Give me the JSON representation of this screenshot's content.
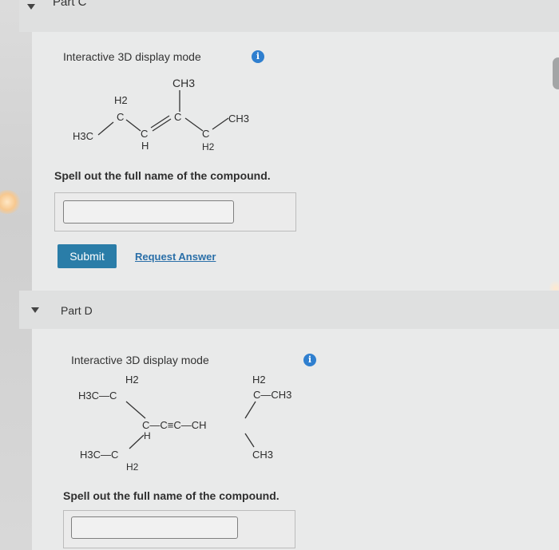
{
  "part_c": {
    "title": "Part C",
    "mode_label": "Interactive 3D display mode",
    "prompt": "Spell out the full name of the compound.",
    "answer_value": "",
    "submit_label": "Submit",
    "request_label": "Request Answer",
    "structure_labels": {
      "ch3_top": "CH3",
      "h2_left": "H2",
      "c_left": "C",
      "ch3_right": "CH3",
      "h3c_left": "H3C",
      "c_right": "C",
      "c_h": "C",
      "h_below": "H",
      "c_h2": "C",
      "h2_below": "H2"
    }
  },
  "part_d": {
    "title": "Part D",
    "mode_label": "Interactive 3D display mode",
    "prompt": "Spell out the full name of the compound.",
    "answer_value": "",
    "structure_labels": {
      "h2_top_left": "H2",
      "h3c_c_top": "H3C—C",
      "h2_top_right": "H2",
      "c_ch3_right": "C—CH3",
      "chain": "C—C≡C—CH",
      "h_mid": "H",
      "h3c_c_bottom": "H3C—C",
      "h2_bottom": "H2",
      "ch3_bottom": "CH3"
    }
  },
  "colors": {
    "accent": "#2a7da8",
    "info": "#2f7fcf"
  }
}
